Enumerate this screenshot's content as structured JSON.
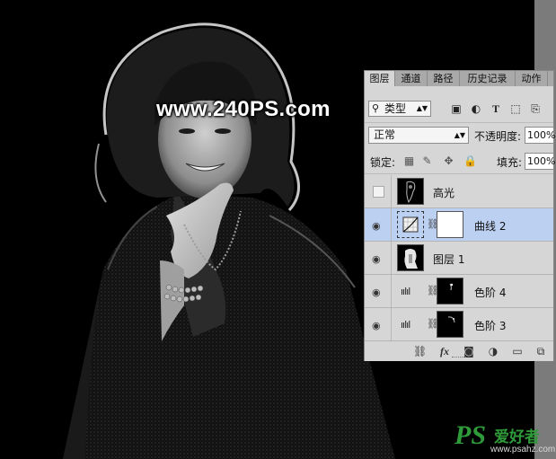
{
  "watermark": {
    "site": "www.240PS.com",
    "logo_mark": "PS",
    "logo_text": "爱好者",
    "logo_url": "www.psahz.com"
  },
  "layers_panel": {
    "tabs": [
      "图层",
      "通道",
      "路径",
      "历史记录",
      "动作"
    ],
    "active_tab": "图层",
    "filter": {
      "label": "类型",
      "icon": "search-icon"
    },
    "filter_icons": [
      "image-filter-icon",
      "adjustment-filter-icon",
      "type-filter-icon",
      "shape-filter-icon",
      "smart-object-filter-icon"
    ],
    "blend_mode": "正常",
    "opacity_label": "不透明度:",
    "opacity_value": "100%",
    "lock_label": "锁定:",
    "fill_label": "填充:",
    "fill_value": "100%",
    "layers": [
      {
        "name": "高光",
        "visible": false,
        "selected": false,
        "type": "pixel"
      },
      {
        "name": "曲线 2",
        "visible": true,
        "selected": true,
        "type": "curves"
      },
      {
        "name": "图层 1",
        "visible": true,
        "selected": false,
        "type": "pixel"
      },
      {
        "name": "色阶 4",
        "visible": true,
        "selected": false,
        "type": "levels"
      },
      {
        "name": "色阶 3",
        "visible": true,
        "selected": false,
        "type": "levels"
      }
    ],
    "footer_icons": [
      "link-layers-icon",
      "fx-icon",
      "add-mask-icon",
      "adjustment-layer-icon",
      "new-group-icon",
      "new-layer-icon"
    ],
    "footer_fx": "fx"
  }
}
